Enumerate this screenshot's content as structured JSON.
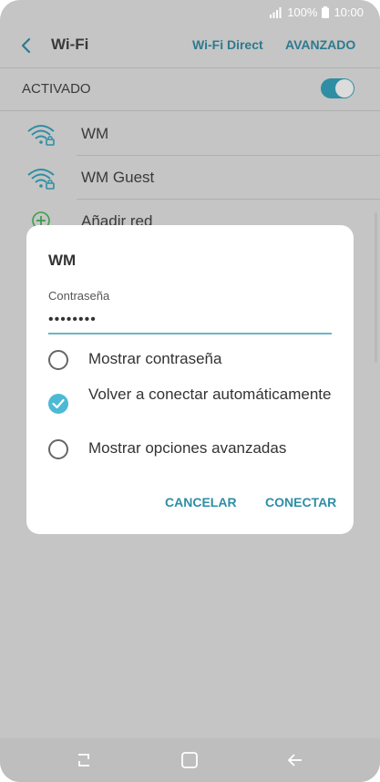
{
  "status_bar": {
    "battery": "100%",
    "time": "10:00"
  },
  "toolbar": {
    "title": "Wi-Fi",
    "wifi_direct": "Wi-Fi Direct",
    "advanced": "AVANZADO"
  },
  "master_switch": {
    "label": "ACTIVADO",
    "on": true
  },
  "networks": [
    {
      "name": "WM",
      "secured": true
    },
    {
      "name": "WM Guest",
      "secured": true
    }
  ],
  "add_network": {
    "label": "Añadir red"
  },
  "dialog": {
    "title": "WM",
    "password_label": "Contraseña",
    "password_value": "••••••••",
    "options": [
      {
        "label": "Mostrar contraseña",
        "checked": false
      },
      {
        "label": "Volver a conectar automáticamente",
        "checked": true
      },
      {
        "label": "Mostrar opciones avanzadas",
        "checked": false
      }
    ],
    "cancel_label": "CANCELAR",
    "connect_label": "CONECTAR"
  },
  "colors": {
    "accent": "#4cbad4",
    "toolbar_link": "#2d7a8f",
    "dim_overlay": "#c5c5c5"
  }
}
